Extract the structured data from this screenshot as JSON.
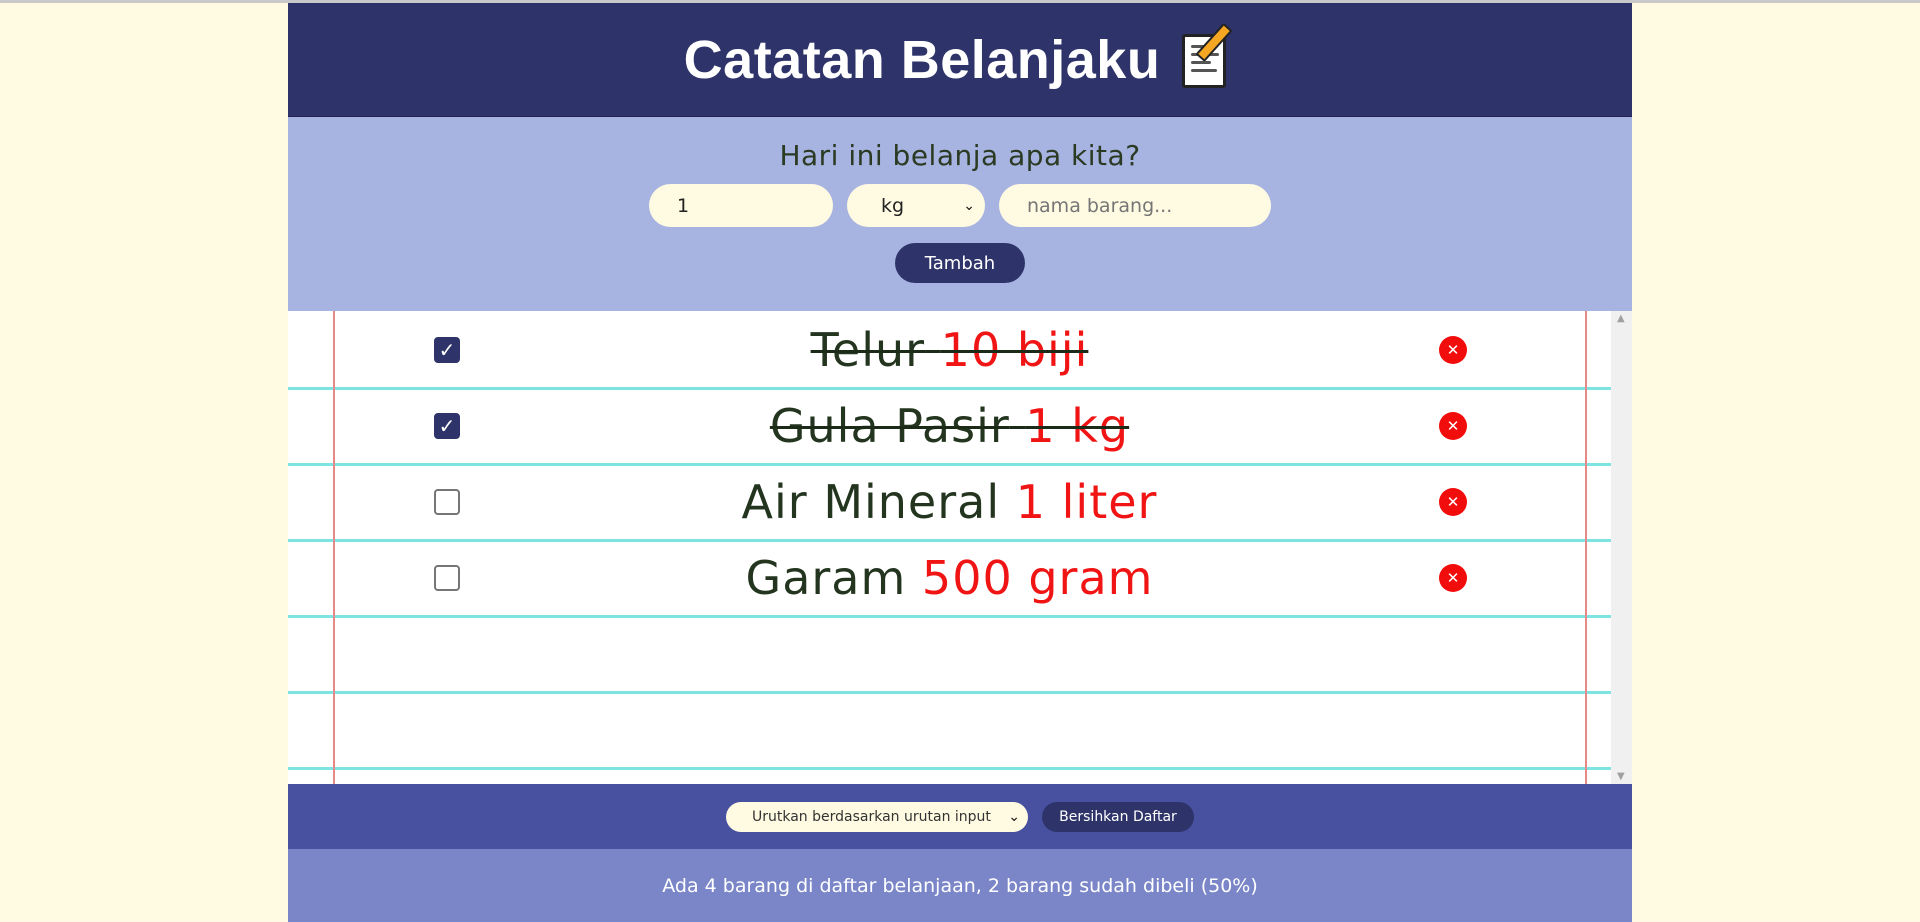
{
  "header": {
    "title": "Catatan Belanjaku",
    "title_icon": "memo-pencil-icon"
  },
  "form": {
    "question": "Hari ini belanja apa kita?",
    "quantity_value": "1",
    "unit_selected": "kg",
    "name_placeholder": "nama barang...",
    "add_label": "Tambah"
  },
  "items": [
    {
      "name": "Telur",
      "amount": "10 biji",
      "checked": true
    },
    {
      "name": "Gula Pasir",
      "amount": "1 kg",
      "checked": true
    },
    {
      "name": "Air Mineral",
      "amount": "1 liter",
      "checked": false
    },
    {
      "name": "Garam",
      "amount": "500 gram",
      "checked": false
    }
  ],
  "controls": {
    "sort_selected": "Urutkan berdasarkan urutan input",
    "clear_label": "Bersihkan Daftar"
  },
  "footer": {
    "summary": "Ada 4 barang di daftar belanjaan, 2 barang sudah dibeli (50%)"
  },
  "colors": {
    "header_bg": "#2e346a",
    "form_bg": "#a7b3e0",
    "controls_bg": "#4850a0",
    "footer_bg": "#7a86c8",
    "amount_red": "#f01414",
    "delete_red": "#f20d0d",
    "page_bg": "#fffbe2"
  }
}
